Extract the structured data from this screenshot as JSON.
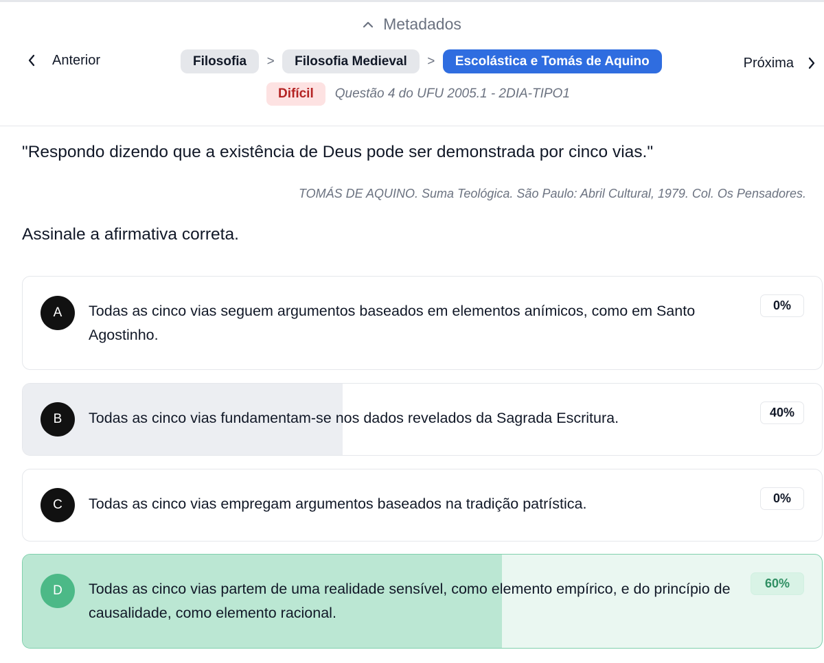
{
  "header": {
    "metadata_toggle": "Metadados",
    "prev_label": "Anterior",
    "next_label": "Próxima",
    "breadcrumbs": [
      "Filosofia",
      "Filosofia Medieval",
      "Escolástica e Tomás de Aquino"
    ],
    "breadcrumb_separator": ">",
    "difficulty": "Difícil",
    "question_source": "Questão 4 do UFU 2005.1 - 2DIA-TIPO1"
  },
  "question": {
    "quote": "\"Respondo dizendo que a existência de Deus pode ser demonstrada por cinco vias.\"",
    "citation": "TOMÁS DE AQUINO. Suma Teológica. São Paulo: Abril Cultural, 1979. Col. Os Pensadores.",
    "prompt": "Assinale a afirmativa correta."
  },
  "options": [
    {
      "letter": "A",
      "text": "Todas as cinco vias seguem argumentos baseados em elementos anímicos, como em Santo Agostinho.",
      "percent_label": "0%",
      "percent": 0,
      "correct": false
    },
    {
      "letter": "B",
      "text": "Todas as cinco vias fundamentam-se nos dados revelados da Sagrada Escritura.",
      "percent_label": "40%",
      "percent": 40,
      "correct": false
    },
    {
      "letter": "C",
      "text": "Todas as cinco vias empregam argumentos baseados na tradição patrística.",
      "percent_label": "0%",
      "percent": 0,
      "correct": false
    },
    {
      "letter": "D",
      "text": "Todas as cinco vias partem de uma realidade sensível, como elemento empírico, e do princípio de causalidade, como elemento racional.",
      "percent_label": "60%",
      "percent": 60,
      "correct": true
    }
  ],
  "colors": {
    "active_breadcrumb": "#2f6de0",
    "difficulty_bg": "#fde2e2",
    "difficulty_text": "#b42323",
    "correct_border": "#7fd0ac",
    "correct_fill": "#bbe7d3",
    "correct_letter": "#4cb987"
  },
  "icons": {
    "metadata_toggle": "chevron-up-icon",
    "prev": "chevron-left-icon",
    "next": "chevron-right-icon"
  }
}
